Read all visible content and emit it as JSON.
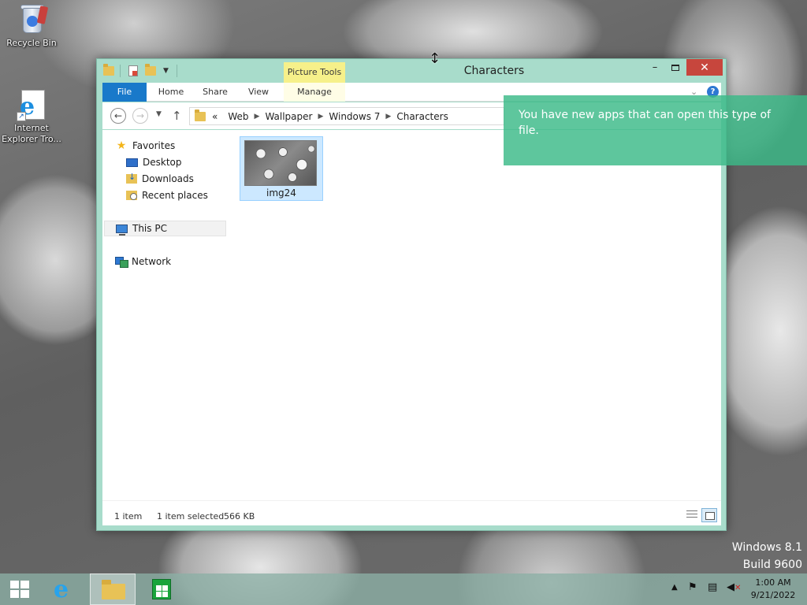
{
  "desktop": {
    "icons": [
      {
        "label": "Recycle Bin"
      },
      {
        "label": "Internet Explorer Tro..."
      }
    ],
    "watermark": {
      "line1": "Windows 8.1",
      "line2": "Build 9600"
    }
  },
  "window": {
    "title": "Characters",
    "context_tab_group": "Picture Tools",
    "controls": {
      "minimize": "–",
      "maximize": "□",
      "close": "✕"
    },
    "ribbon_tabs": [
      {
        "label": "File"
      },
      {
        "label": "Home"
      },
      {
        "label": "Share"
      },
      {
        "label": "View"
      },
      {
        "label": "Manage"
      }
    ],
    "address": {
      "overflow": "«",
      "crumbs": [
        "Web",
        "Wallpaper",
        "Windows 7",
        "Characters"
      ]
    },
    "nav_pane": {
      "favorites": "Favorites",
      "desktop": "Desktop",
      "downloads": "Downloads",
      "recent_places": "Recent places",
      "this_pc": "This PC",
      "network": "Network"
    },
    "files": [
      {
        "name": "img24",
        "selected": true
      }
    ],
    "status": {
      "count": "1 item",
      "selected": "1 item selected",
      "size": "566 KB"
    }
  },
  "toast": {
    "message": "You have new apps that can open this type of file."
  },
  "taskbar": {
    "clock_time": "1:00 AM",
    "clock_date": "9/21/2022"
  },
  "colors": {
    "window_frame": "#a8dccb",
    "file_tab": "#1979ca",
    "close_button": "#c7463d",
    "toast": "#3bba87",
    "context_tab": "#f6f08a"
  },
  "icons": {
    "recycle_bin": "recycle-bin-icon",
    "internet_explorer": "internet-explorer-icon",
    "folder": "folder-icon",
    "help": "help-icon",
    "store": "store-icon"
  }
}
